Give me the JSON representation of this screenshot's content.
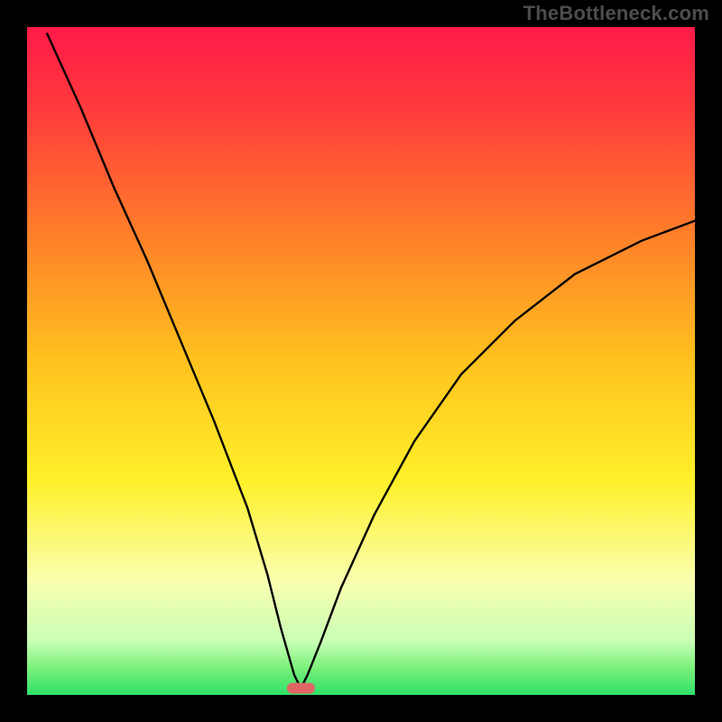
{
  "watermark": "TheBottleneck.com",
  "chart_data": {
    "type": "line",
    "title": "",
    "xlabel": "",
    "ylabel": "",
    "xlim": [
      0,
      100
    ],
    "ylim": [
      0,
      100
    ],
    "grid": false,
    "legend": false,
    "note": "V-shaped bottleneck curve rendered over a vertical rainbow gradient (red→yellow→green) inside a black frame. Values are read visually: y≈100 is top (worst bottleneck / red), y≈0 is bottom (no bottleneck / green). The minimum of the curve sits roughly at x≈41 near y≈0, marked by a small red rounded pill.",
    "series": [
      {
        "name": "bottleneck-curve",
        "x": [
          3,
          8,
          13,
          18,
          23,
          28,
          33,
          36,
          38,
          40,
          41,
          42,
          44,
          47,
          52,
          58,
          65,
          73,
          82,
          92,
          100
        ],
        "values": [
          99,
          88,
          76,
          65,
          53,
          41,
          28,
          18,
          10,
          3,
          1,
          3,
          8,
          16,
          27,
          38,
          48,
          56,
          63,
          68,
          71
        ]
      }
    ],
    "marker": {
      "x": 41,
      "y": 1,
      "width_pct": 4.2,
      "label": "optimal-point"
    },
    "gradient_stops": [
      {
        "pct": 0,
        "color": "#ff1a49"
      },
      {
        "pct": 12,
        "color": "#ff3a3c"
      },
      {
        "pct": 30,
        "color": "#ff7b2a"
      },
      {
        "pct": 50,
        "color": "#ffc21e"
      },
      {
        "pct": 68,
        "color": "#fff02a"
      },
      {
        "pct": 83,
        "color": "#faffb0"
      },
      {
        "pct": 92,
        "color": "#c8ffb5"
      },
      {
        "pct": 96,
        "color": "#7af07a"
      },
      {
        "pct": 100,
        "color": "#2fe06a"
      }
    ],
    "frame": {
      "outer": 800,
      "border": 30
    }
  }
}
